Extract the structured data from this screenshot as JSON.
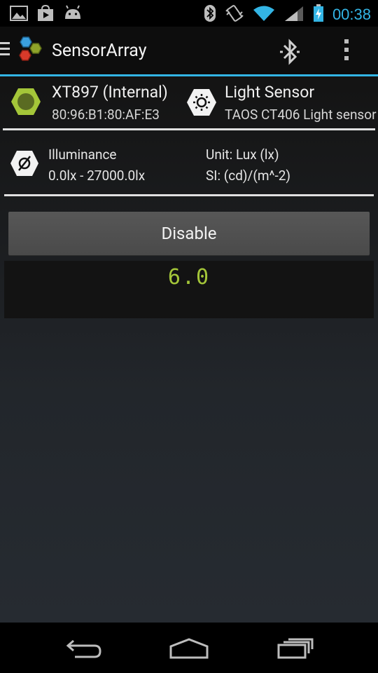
{
  "status_bar": {
    "time": "00:38",
    "left_icons": [
      "image-icon",
      "play-store-icon",
      "android-icon"
    ],
    "right_icons": [
      "bluetooth-icon",
      "vibrate-icon",
      "wifi-icon",
      "signal-icon",
      "battery-charging-icon"
    ]
  },
  "action_bar": {
    "title": "SensorArray",
    "icons": [
      "hamburger-icon",
      "app-logo-icon",
      "bluetooth-action-icon",
      "overflow-menu-icon"
    ]
  },
  "device": {
    "name": "XT897 (Internal)",
    "address": "80:96:B1:80:AF:E3"
  },
  "sensor": {
    "name": "Light Sensor",
    "description": "TAOS CT406 Light sensor"
  },
  "measurement": {
    "type": "Illuminance",
    "range": "0.0lx - 27000.0lx",
    "unit": "Unit: Lux (lx)",
    "si": "SI: (cd)/(m^-2)"
  },
  "controls": {
    "disable_label": "Disable"
  },
  "readout": {
    "value": "6.0"
  },
  "colors": {
    "accent": "#33b5e5",
    "readout": "#a4c639",
    "hex_device": "#a4c639"
  },
  "nav_bar": {
    "icons": [
      "back-icon",
      "home-icon",
      "recent-apps-icon"
    ]
  }
}
